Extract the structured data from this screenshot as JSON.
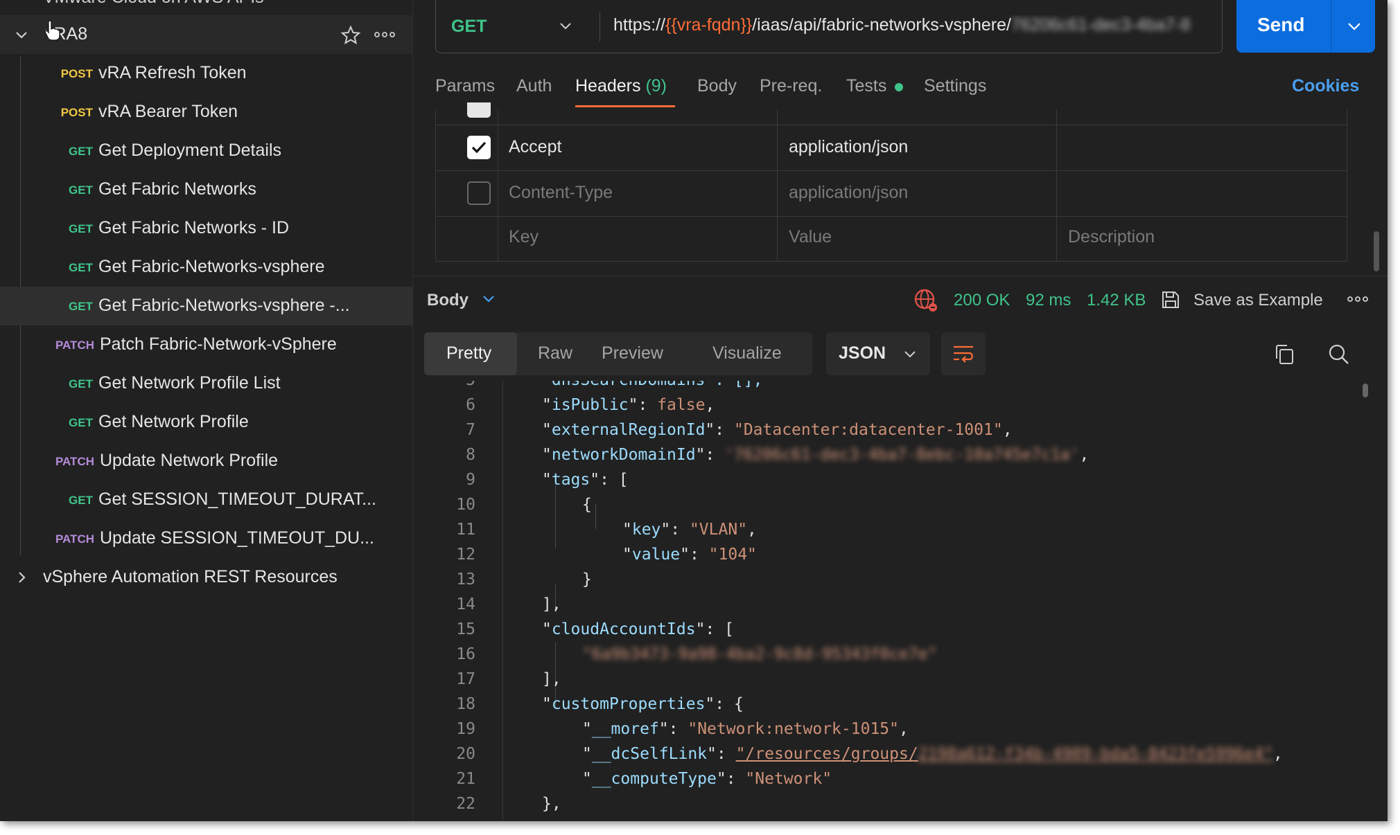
{
  "colors": {
    "get": "#3fc48a",
    "post": "#f2c744",
    "patch": "#b58bd9",
    "accent": "#ff6c37",
    "link": "#4a9ff0",
    "send": "#0c6ddf",
    "status_ok": "#3fc48a"
  },
  "sidebar": {
    "top_clipped": "VMware Cloud on AWS APIs",
    "collection": {
      "name": "vRA8"
    },
    "items": [
      {
        "method": "POST",
        "name": "vRA Refresh Token"
      },
      {
        "method": "POST",
        "name": "vRA Bearer Token"
      },
      {
        "method": "GET",
        "name": "Get Deployment Details"
      },
      {
        "method": "GET",
        "name": "Get Fabric Networks"
      },
      {
        "method": "GET",
        "name": "Get Fabric Networks - ID"
      },
      {
        "method": "GET",
        "name": "Get Fabric-Networks-vsphere"
      },
      {
        "method": "GET",
        "name": "Get Fabric-Networks-vsphere -..."
      },
      {
        "method": "PATCH",
        "name": "Patch Fabric-Network-vSphere"
      },
      {
        "method": "GET",
        "name": "Get Network Profile List"
      },
      {
        "method": "GET",
        "name": "Get Network Profile"
      },
      {
        "method": "PATCH",
        "name": "Update Network Profile"
      },
      {
        "method": "GET",
        "name": "Get SESSION_TIMEOUT_DURAT..."
      },
      {
        "method": "PATCH",
        "name": "Update SESSION_TIMEOUT_DU..."
      }
    ],
    "next_collection": "vSphere Automation REST Resources"
  },
  "request": {
    "method": "GET",
    "url_prefix": "https://",
    "url_var": "{{vra-fqdn}}",
    "url_path": "/iaas/api/fabric-networks-vsphere/",
    "url_blurred": "76206c61-dec3-4ba7-8",
    "send_label": "Send"
  },
  "tabs": {
    "params": "Params",
    "auth": "Auth",
    "headers": "Headers",
    "headers_count": "(9)",
    "body": "Body",
    "prereq": "Pre-req.",
    "tests": "Tests",
    "settings": "Settings",
    "cookies": "Cookies"
  },
  "headers_table": {
    "rows": [
      {
        "key": "Accept",
        "value": "application/json",
        "checked": true
      },
      {
        "key": "Content-Type",
        "value": "application/json",
        "checked": false
      }
    ],
    "placeholders": {
      "key": "Key",
      "value": "Value",
      "description": "Description"
    }
  },
  "response": {
    "section": "Body",
    "status": "200 OK",
    "time": "92 ms",
    "size": "1.42 KB",
    "save_example": "Save as Example",
    "views": [
      "Pretty",
      "Raw",
      "Preview",
      "Visualize"
    ],
    "format": "JSON"
  },
  "code": {
    "top_clip": "\"dnsSearchDomains\": [],",
    "lines": [
      {
        "n": "6",
        "indent": 0,
        "key": "isPublic",
        "val": "false",
        "vtype": "bool",
        "end": ","
      },
      {
        "n": "7",
        "indent": 0,
        "key": "externalRegionId",
        "val": "\"Datacenter:datacenter-1001\"",
        "vtype": "str",
        "end": ","
      },
      {
        "n": "8",
        "indent": 0,
        "key": "networkDomainId",
        "val": "'76206c61-dec3-4ba7-8ebc-10a745e7c1a'",
        "vtype": "blur",
        "end": ","
      },
      {
        "n": "9",
        "indent": 0,
        "key": "tags",
        "val": "[",
        "vtype": "punct",
        "end": ""
      },
      {
        "n": "10",
        "indent": 1,
        "key": "",
        "val": "{",
        "vtype": "punct",
        "end": ""
      },
      {
        "n": "11",
        "indent": 2,
        "key": "key",
        "val": "\"VLAN\"",
        "vtype": "str",
        "end": ","
      },
      {
        "n": "12",
        "indent": 2,
        "key": "value",
        "val": "\"104\"",
        "vtype": "str",
        "end": ""
      },
      {
        "n": "13",
        "indent": 1,
        "key": "",
        "val": "}",
        "vtype": "punct",
        "end": ""
      },
      {
        "n": "14",
        "indent": 0,
        "key": "",
        "val": "],",
        "vtype": "punct",
        "end": ""
      },
      {
        "n": "15",
        "indent": 0,
        "key": "cloudAccountIds",
        "val": "[",
        "vtype": "punct",
        "end": ""
      },
      {
        "n": "16",
        "indent": 1,
        "key": "",
        "val": "\"6a9b3473-9a98-4ba2-9c8d-95343f0ce7e\"",
        "vtype": "blur",
        "end": ""
      },
      {
        "n": "17",
        "indent": 0,
        "key": "",
        "val": "],",
        "vtype": "punct",
        "end": ""
      },
      {
        "n": "18",
        "indent": 0,
        "key": "customProperties",
        "val": "{",
        "vtype": "punct",
        "end": ""
      },
      {
        "n": "19",
        "indent": 1,
        "key": "__moref",
        "val": "\"Network:network-1015\"",
        "vtype": "str",
        "end": ","
      },
      {
        "n": "20",
        "indent": 1,
        "key": "__dcSelfLink",
        "val": "\"/resources/groups/",
        "vtype": "link",
        "blur_tail": "2198a612-f34b-4909-bda5-8423fe5996e4\"",
        "end": ","
      },
      {
        "n": "21",
        "indent": 1,
        "key": "__computeType",
        "val": "\"Network\"",
        "vtype": "str",
        "end": ""
      },
      {
        "n": "22",
        "indent": 0,
        "key": "",
        "val": "},",
        "vtype": "punct",
        "end": ""
      }
    ]
  }
}
